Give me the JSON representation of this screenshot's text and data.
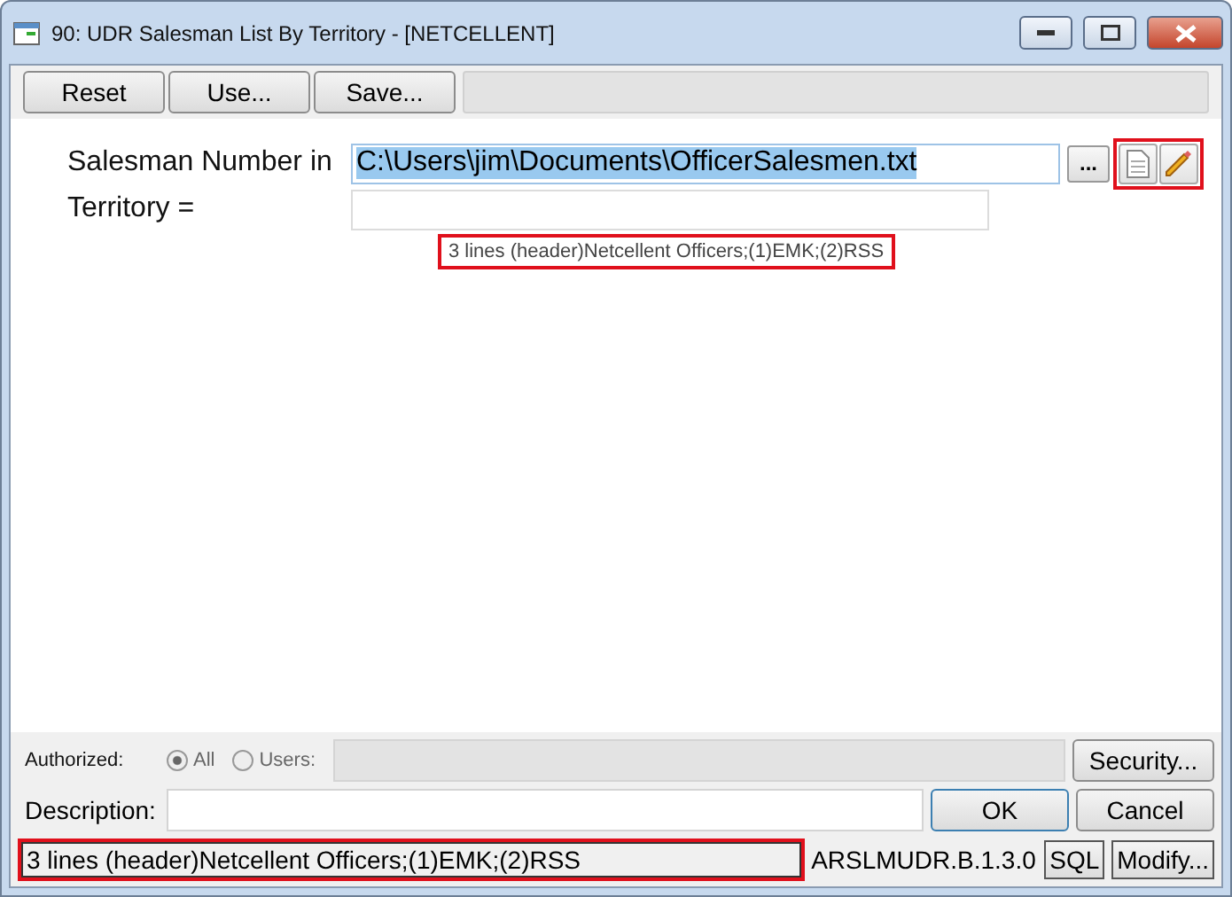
{
  "window": {
    "title": "90:  UDR Salesman List By Territory - [NETCELLENT]"
  },
  "toolbar": {
    "buttons": [
      "Reset",
      "Use...",
      "Save..."
    ]
  },
  "criteria": [
    {
      "label": "Salesman Number in",
      "value": "C:\\Users\\jim\\Documents\\OfficerSalesmen.txt",
      "selected": true,
      "browse": "..."
    },
    {
      "label": "Territory =",
      "selected": false
    }
  ],
  "hint": "3 lines (header)Netcellent Officers;(1)EMK;(2)RSS",
  "authorized": {
    "label": "Authorized:",
    "options": [
      {
        "label": "All",
        "selected": true
      },
      {
        "label": "Users:",
        "selected": false
      }
    ],
    "security": "Security..."
  },
  "description": {
    "label": "Description:"
  },
  "buttons": [
    "OK",
    "Cancel"
  ],
  "status_bar": {
    "message": "3 lines (header)Netcellent Officers;(1)EMK;(2)RSS",
    "program": "ARSLMUDR.B.1.3.0",
    "buttons": [
      "SQL",
      "Modify..."
    ]
  }
}
